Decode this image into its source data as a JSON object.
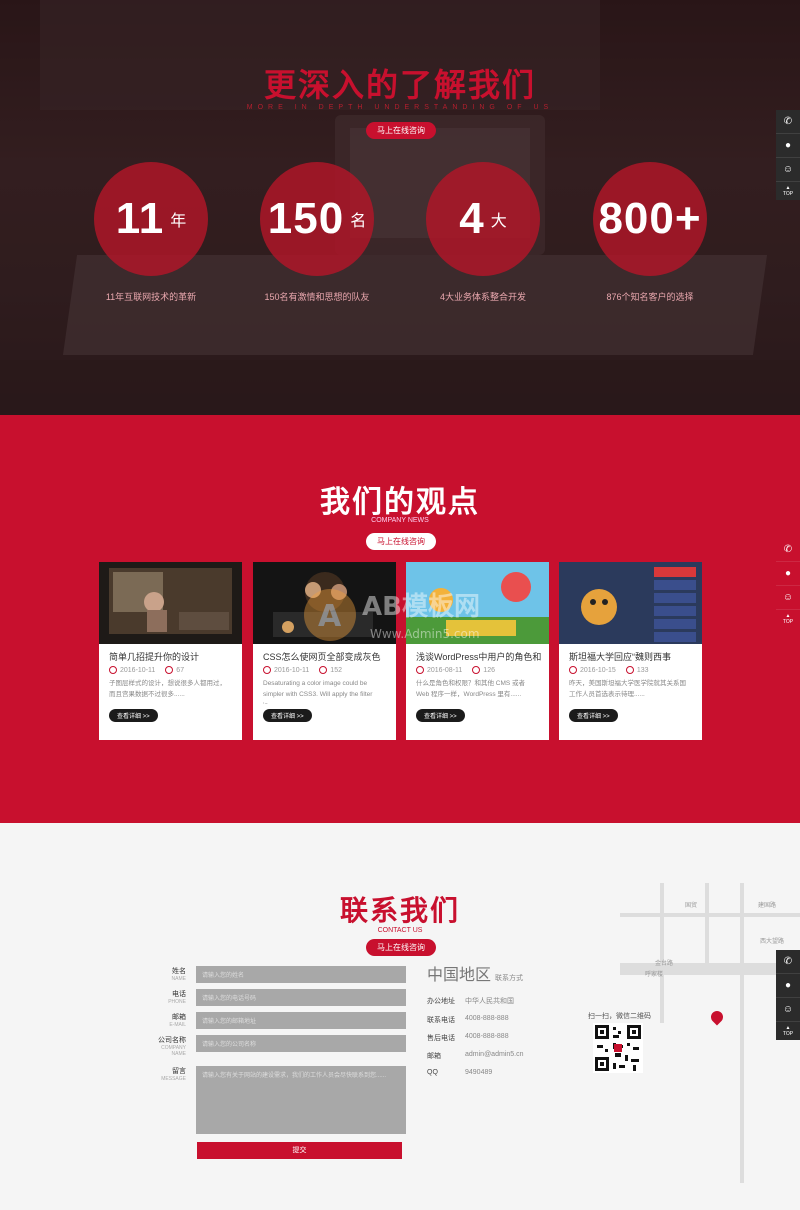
{
  "hero": {
    "title": "更深入的了解我们",
    "subtitle": "MORE IN DEPTH UNDERSTANDING OF US",
    "button": "马上在线咨询",
    "stats": [
      {
        "num": "11",
        "unit": "年",
        "caption": "11年互联网技术的革新"
      },
      {
        "num": "150",
        "unit": "名",
        "caption": "150名有激情和思想的队友"
      },
      {
        "num": "4",
        "unit": "大",
        "caption": "4大业务体系整合开发"
      },
      {
        "num": "800+",
        "unit": "",
        "caption": "876个知名客户的选择"
      }
    ]
  },
  "news": {
    "title": "我们的观点",
    "subtitle": "COMPANY NEWS",
    "button": "马上在线咨询",
    "more": "查看详细 >>",
    "cards": [
      {
        "title": "简单几招提升你的设计",
        "date": "2016-10-11",
        "views": "67",
        "desc": "子图层样式的设计，想说很多人都用过，而且宫果数据不过很多......"
      },
      {
        "title": "CSS怎么使网页全部变成灰色",
        "date": "2016-10-11",
        "views": "152",
        "desc": "Desaturating a color image could be simpler with CSS3. Will apply the filter in......"
      },
      {
        "title": "浅谈WordPress中用户的角色和",
        "date": "2016-08-11",
        "views": "126",
        "desc": "什么是角色和权限？和其他 CMS 或者 Web 程序一样，WordPress 里有......"
      },
      {
        "title": "斯坦福大学回应“魏则西事",
        "date": "2016-10-15",
        "views": "133",
        "desc": "昨天，美国斯坦福大学医学院就其关系国工作人员首选表示待理......"
      }
    ]
  },
  "watermark": {
    "brand": "AB模板网",
    "url": "Www.Admin5.com"
  },
  "contact": {
    "title": "联系我们",
    "subtitle": "CONTACT US",
    "button": "马上在线咨询",
    "fields": [
      {
        "cn": "姓名",
        "en": "NAME",
        "placeholder": "请输入您的姓名"
      },
      {
        "cn": "电话",
        "en": "PHONE",
        "placeholder": "请输入您的电话号码"
      },
      {
        "cn": "邮箱",
        "en": "E-MAIL",
        "placeholder": "请输入您的邮箱地址"
      },
      {
        "cn": "公司名称",
        "en": "COMPANY NAME",
        "placeholder": "请输入您的公司名称"
      },
      {
        "cn": "留言",
        "en": "MESSAGE",
        "placeholder": "请输入您有关于网站的建设需求，我们的工作人员会尽快联系到您......"
      }
    ],
    "submit": "提交",
    "region": "中国地区",
    "region_small": "联系方式",
    "info": [
      {
        "k": "办公地址",
        "v": "中华人民共和国"
      },
      {
        "k": "联系电话",
        "v": "4008-888-888"
      },
      {
        "k": "售后电话",
        "v": "4008-888-888"
      },
      {
        "k": "邮箱",
        "v": "admin@admin5.cn"
      },
      {
        "k": "QQ",
        "v": "9490489"
      }
    ],
    "qr_caption": "扫一扫，微信二维码",
    "map_labels": [
      "国贸",
      "建国路",
      "金台路",
      "呼家楼",
      "西大望路"
    ]
  },
  "sidebar": {
    "top": "TOP"
  },
  "colors": {
    "brand": "#c8102e",
    "dark": "#2b2b2b"
  }
}
